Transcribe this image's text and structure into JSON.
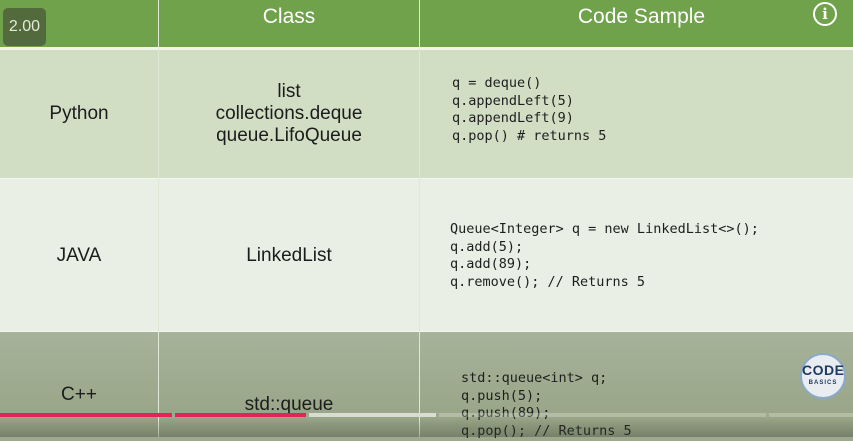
{
  "player": {
    "speed_label": "2.00",
    "info_label": "i",
    "progress": {
      "played_fraction": 0.36,
      "buffered_fraction": 0.515
    }
  },
  "table": {
    "headers": [
      "Class",
      "Code Sample"
    ],
    "rows": [
      {
        "language": "Python",
        "classes": [
          "list",
          "collections.deque",
          "queue.LifoQueue"
        ],
        "code": [
          "q = deque()",
          "q.appendLeft(5)",
          "q.appendLeft(9)",
          "q.pop() # returns 5"
        ]
      },
      {
        "language": "JAVA",
        "classes": [
          "LinkedList"
        ],
        "code": [
          "Queue<Integer> q = new LinkedList<>();",
          "q.add(5);",
          "q.add(89);",
          "q.remove(); // Returns 5"
        ]
      },
      {
        "language": "C++",
        "classes": [
          "std::queue"
        ],
        "code": [
          "std::queue<int> q;",
          "q.push(5);",
          "q.push(89);",
          "q.pop(); // Returns 5"
        ]
      }
    ]
  },
  "logo": {
    "main": "CODE",
    "sub": "BASICS"
  },
  "colors": {
    "header_green": "#6fa24a",
    "progress_played": "#e3245a",
    "progress_buffered": "#d9dcd3"
  }
}
